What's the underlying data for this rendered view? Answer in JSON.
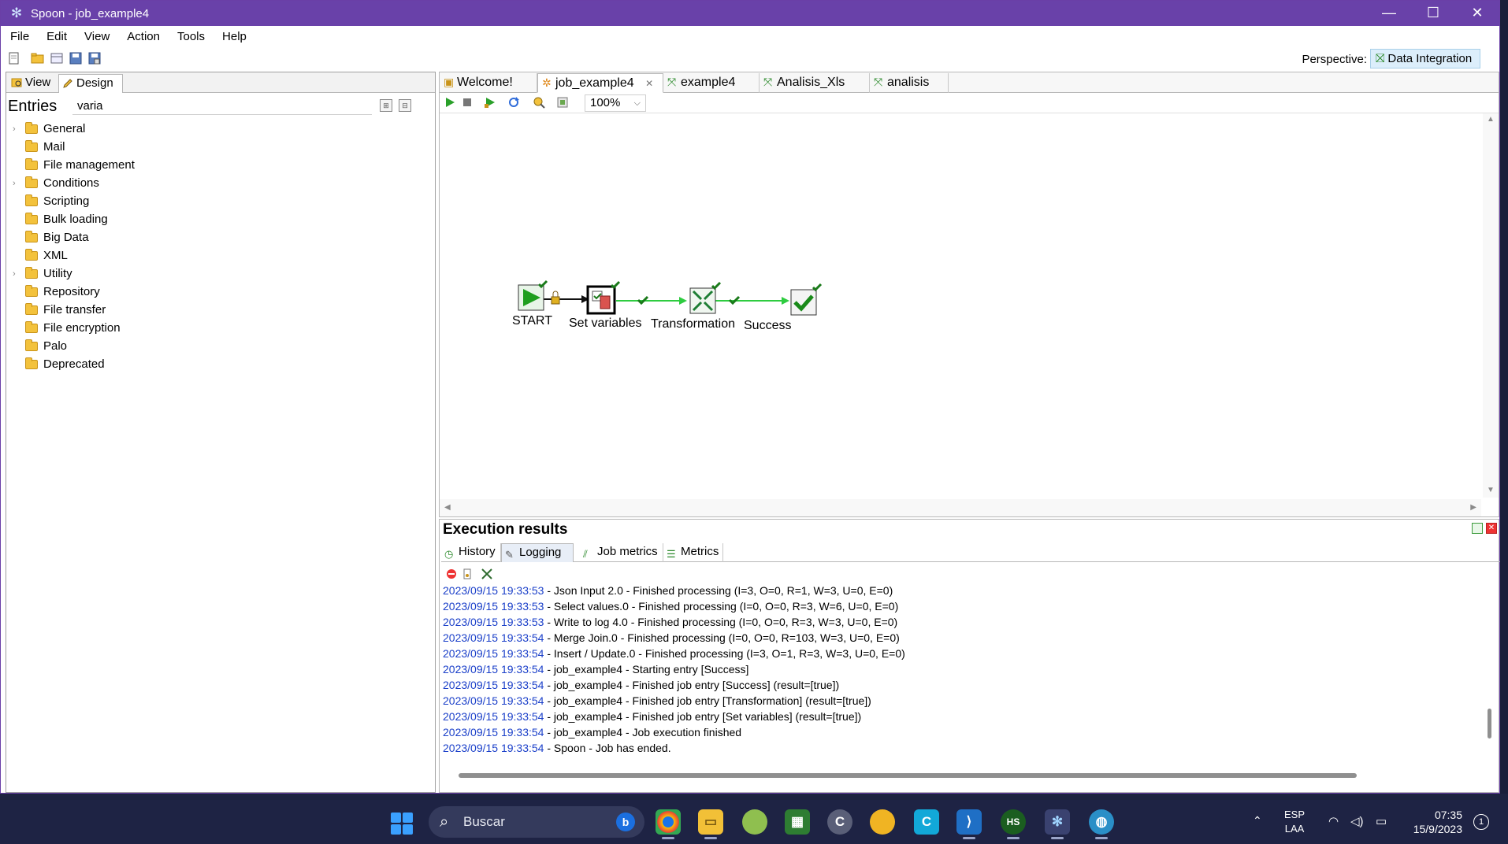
{
  "window": {
    "title": "Spoon - job_example4",
    "controls": [
      "—",
      "☐",
      "✕"
    ]
  },
  "menu": [
    "File",
    "Edit",
    "View",
    "Action",
    "Tools",
    "Help"
  ],
  "perspective": {
    "label": "Perspective:",
    "value": "Data Integration"
  },
  "left_panel": {
    "tabs": [
      "View",
      "Design"
    ],
    "entries_label": "Entries",
    "search_value": "varia",
    "tree": [
      {
        "label": "General",
        "expandable": true
      },
      {
        "label": "Mail",
        "expandable": false
      },
      {
        "label": "File management",
        "expandable": false
      },
      {
        "label": "Conditions",
        "expandable": true
      },
      {
        "label": "Scripting",
        "expandable": false
      },
      {
        "label": "Bulk loading",
        "expandable": false
      },
      {
        "label": "Big Data",
        "expandable": false
      },
      {
        "label": "XML",
        "expandable": false
      },
      {
        "label": "Utility",
        "expandable": true
      },
      {
        "label": "Repository",
        "expandable": false
      },
      {
        "label": "File transfer",
        "expandable": false
      },
      {
        "label": "File encryption",
        "expandable": false
      },
      {
        "label": "Palo",
        "expandable": false
      },
      {
        "label": "Deprecated",
        "expandable": false
      }
    ]
  },
  "editor": {
    "tabs": [
      "Welcome!",
      "job_example4",
      "example4",
      "Analisis_Xls",
      "analisis"
    ],
    "active_tab": "job_example4",
    "zoom": "100%",
    "nodes": [
      "START",
      "Set variables",
      "Transformation",
      "Success"
    ]
  },
  "execution": {
    "title": "Execution results",
    "tabs": [
      "History",
      "Logging",
      "Job metrics",
      "Metrics"
    ],
    "active_tab": "Logging",
    "log": [
      {
        "ts": "2023/09/15 19:33:53",
        "msg": " - Json Input 2.0 - Finished processing (I=3, O=0, R=1, W=3, U=0, E=0)"
      },
      {
        "ts": "2023/09/15 19:33:53",
        "msg": " - Select values.0 - Finished processing (I=0, O=0, R=3, W=6, U=0, E=0)"
      },
      {
        "ts": "2023/09/15 19:33:53",
        "msg": " - Write to log 4.0 - Finished processing (I=0, O=0, R=3, W=3, U=0, E=0)"
      },
      {
        "ts": "2023/09/15 19:33:54",
        "msg": " - Merge Join.0 - Finished processing (I=0, O=0, R=103, W=3, U=0, E=0)"
      },
      {
        "ts": "2023/09/15 19:33:54",
        "msg": " - Insert / Update.0 - Finished processing (I=3, O=1, R=3, W=3, U=0, E=0)"
      },
      {
        "ts": "2023/09/15 19:33:54",
        "msg": " - job_example4 - Starting entry [Success]"
      },
      {
        "ts": "2023/09/15 19:33:54",
        "msg": " - job_example4 - Finished job entry [Success] (result=[true])"
      },
      {
        "ts": "2023/09/15 19:33:54",
        "msg": " - job_example4 - Finished job entry [Transformation] (result=[true])"
      },
      {
        "ts": "2023/09/15 19:33:54",
        "msg": " - job_example4 - Finished job entry [Set variables] (result=[true])"
      },
      {
        "ts": "2023/09/15 19:33:54",
        "msg": " - job_example4 - Job execution finished"
      },
      {
        "ts": "2023/09/15 19:33:54",
        "msg": " - Spoon - Job has ended."
      }
    ]
  },
  "taskbar": {
    "search_placeholder": "Buscar",
    "lang": "ESP",
    "layout": "LAA",
    "time": "07:35",
    "date": "15/9/2023",
    "notifications": "1"
  },
  "colors": {
    "titlebar": "#6941a9",
    "log_timestamp": "#1a3fc9",
    "hop": "#2ecc40",
    "taskbar": "#1e2344"
  }
}
